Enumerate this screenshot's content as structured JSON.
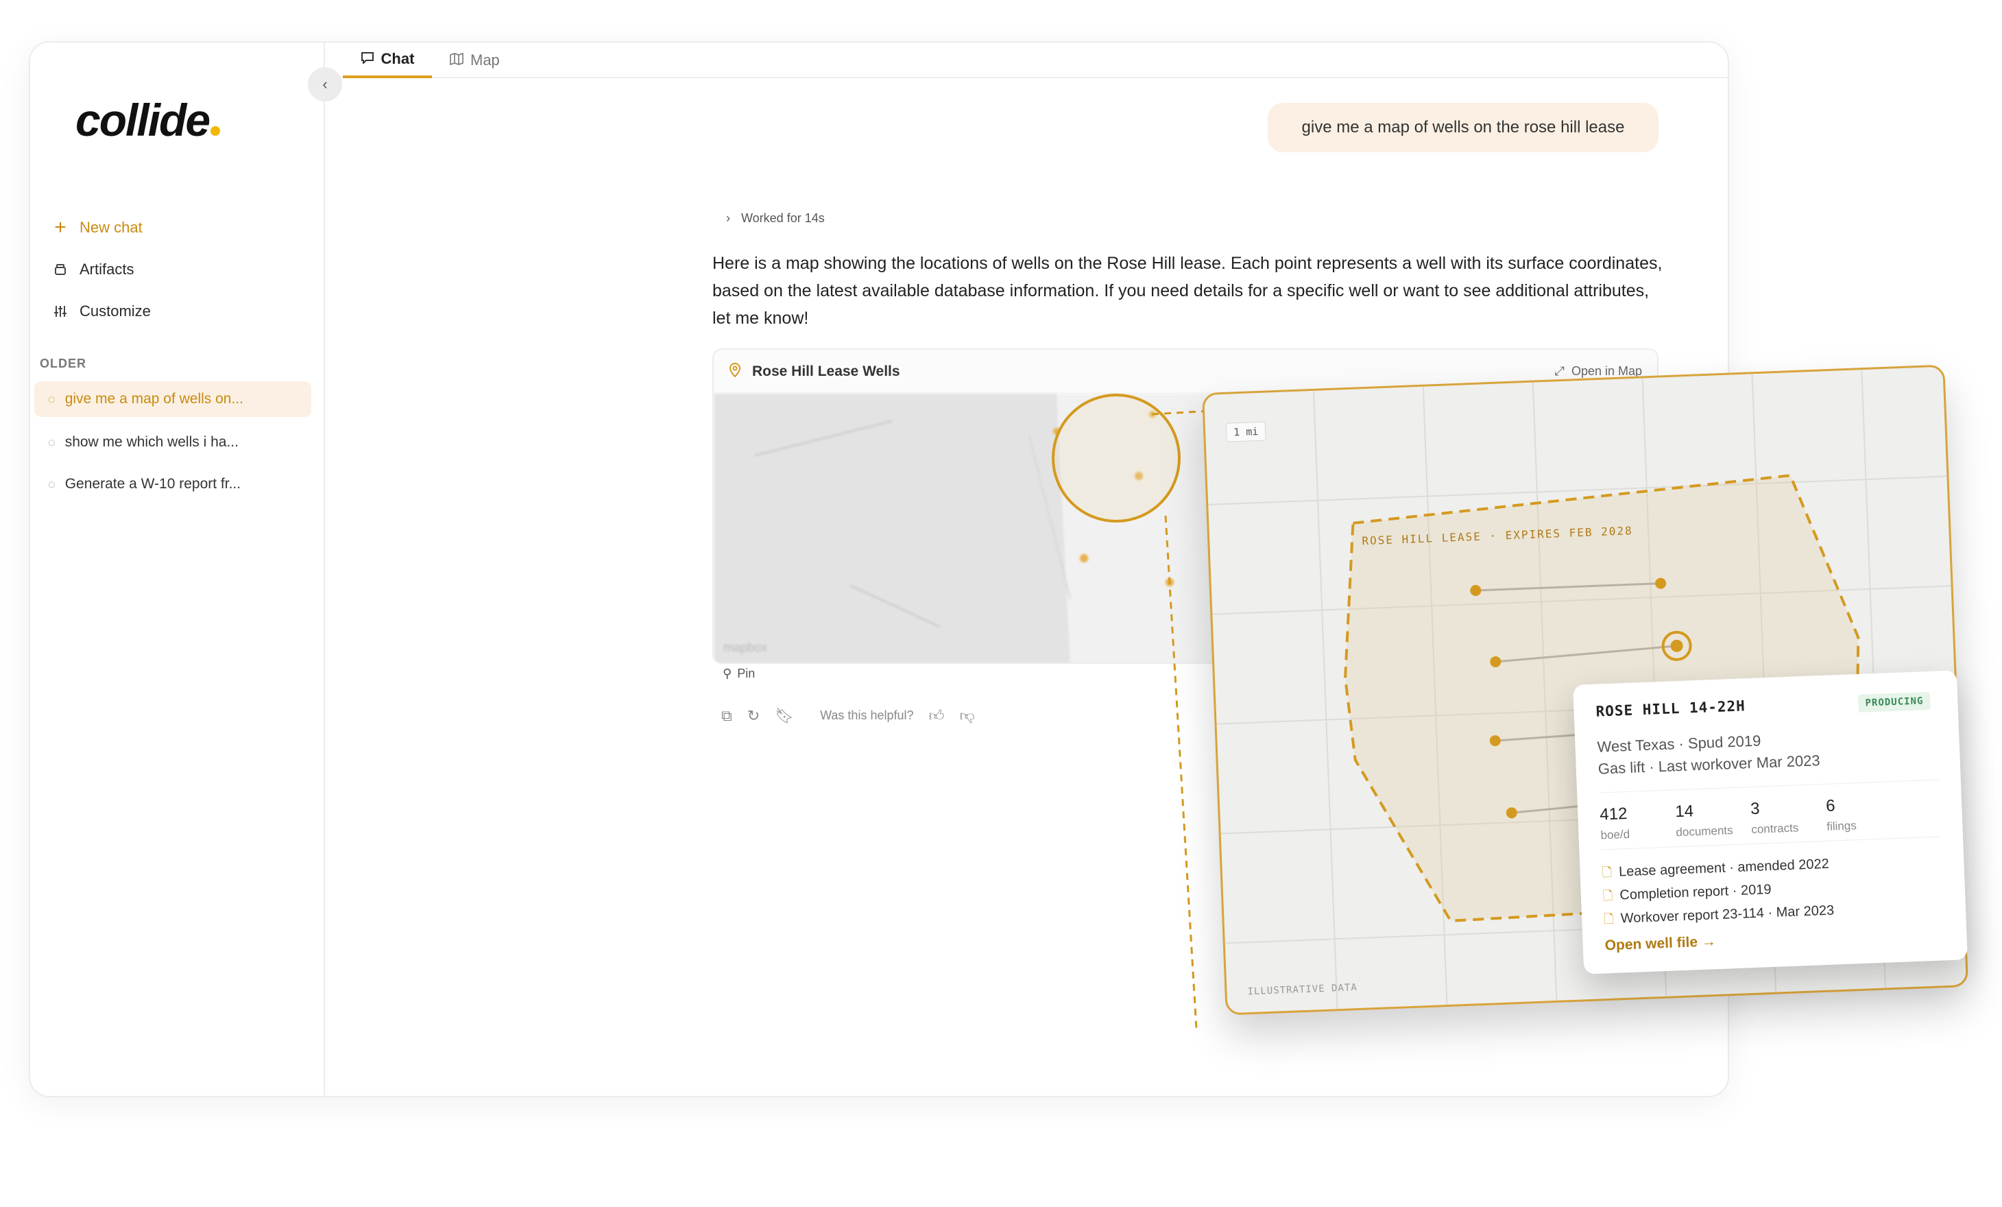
{
  "sidebar": {
    "logo": "collide",
    "new_chat": "New chat",
    "artifacts": "Artifacts",
    "customize": "Customize",
    "older_label": "OLDER",
    "chats": [
      "give me a map of wells on...",
      "show me which wells i ha...",
      "Generate a W-10 report fr..."
    ]
  },
  "tabs": {
    "chat": "Chat",
    "map": "Map"
  },
  "conversation": {
    "user_message": "give me a map of wells on the rose hill lease",
    "worked": "Worked for 14s",
    "answer": "Here is a map showing the locations of wells on the Rose Hill lease. Each point represents a well with its surface coordinates, based on the latest available database information. If you need details for a specific well or want to see additional attributes, let me know!",
    "map_card": {
      "title": "Rose Hill Lease Wells",
      "open_in_map": "Open in Map",
      "attribution": "mapbox"
    },
    "pin": "Pin",
    "helpful": "Was this helpful?"
  },
  "zoom_map": {
    "scale": "1 mi",
    "lease_label": "ROSE HILL LEASE · EXPIRES FEB 2028",
    "footer": "ILLUSTRATIVE DATA"
  },
  "well_popup": {
    "name": "ROSE HILL 14-22H",
    "status": "PRODUCING",
    "meta_line1": "West Texas · Spud 2019",
    "meta_line2": "Gas lift · Last workover Mar 2023",
    "stats": [
      {
        "value": "412",
        "label": "boe/d"
      },
      {
        "value": "14",
        "label": "documents"
      },
      {
        "value": "3",
        "label": "contracts"
      },
      {
        "value": "6",
        "label": "filings"
      }
    ],
    "docs": [
      "Lease agreement · amended 2022",
      "Completion report · 2019",
      "Workover report 23-114 · Mar 2023"
    ],
    "open_file": "Open well file →"
  },
  "colors": {
    "accent": "#d49a1f",
    "accent_bg": "#fbf0e3",
    "producing": "#3a8a55"
  }
}
